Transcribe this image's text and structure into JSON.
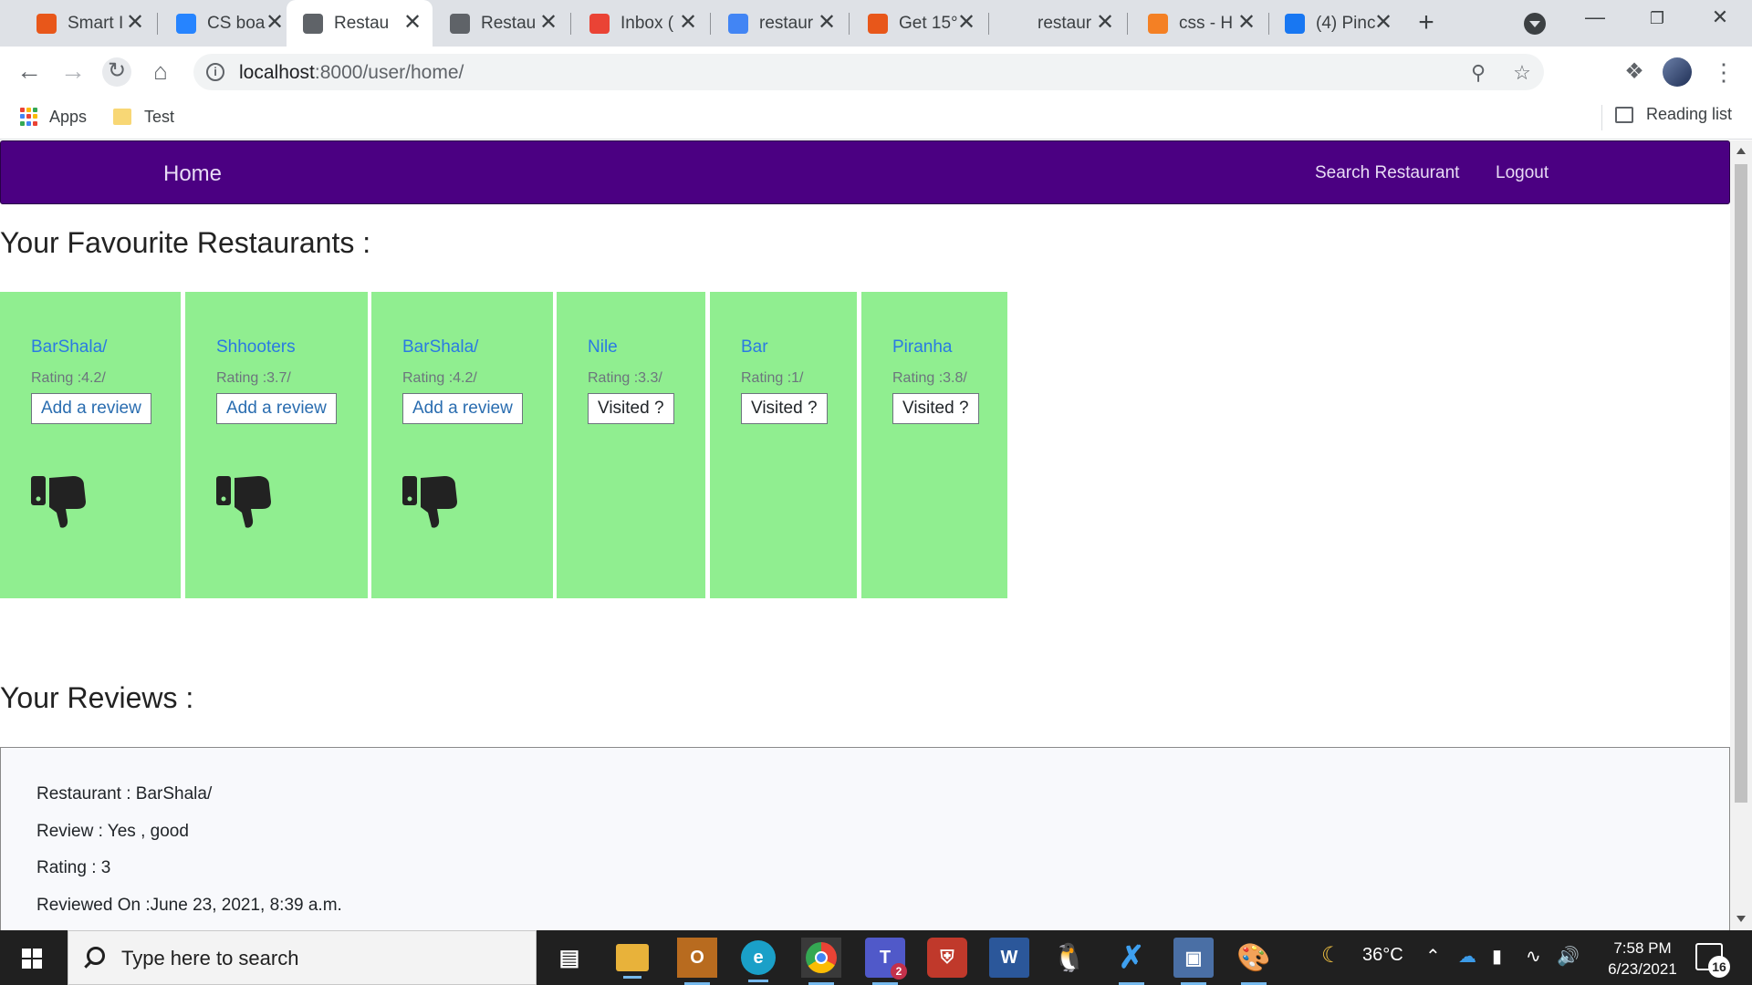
{
  "browser": {
    "tabs": [
      {
        "title": "Smart I",
        "icon": "smartsheet-icon",
        "color": "#e8571a"
      },
      {
        "title": "CS boa",
        "icon": "jira-icon",
        "color": "#2684ff"
      },
      {
        "title": "Restau",
        "icon": "globe-icon",
        "color": "#5f6368",
        "active": true
      },
      {
        "title": "Restau",
        "icon": "document-icon",
        "color": "#5f6368"
      },
      {
        "title": "Inbox (",
        "icon": "gmail-icon",
        "color": "#ea4335"
      },
      {
        "title": "restaur",
        "icon": "google-icon",
        "color": "#4285f4"
      },
      {
        "title": "Get 15°",
        "icon": "coupon-icon",
        "color": "#e8571a"
      },
      {
        "title": "restaur",
        "icon": "blank-icon",
        "color": "#dee1e6"
      },
      {
        "title": "css - H",
        "icon": "stackoverflow-icon",
        "color": "#f48024"
      },
      {
        "title": "(4) Pinc",
        "icon": "facebook-icon",
        "color": "#1877f2"
      }
    ],
    "tab_close_glyph": "✕",
    "new_tab_glyph": "+",
    "url_host": "localhost",
    "url_path": ":8000/user/home/",
    "bookmarks": {
      "apps_label": "Apps",
      "folder_label": "Test",
      "reading_list_label": "Reading list"
    }
  },
  "site": {
    "brand": "Home",
    "nav_links": [
      "Search Restaurant",
      "Logout"
    ],
    "favourites_title": "Your Favourite Restaurants :",
    "reviews_title": "Your Reviews :",
    "restaurants": [
      {
        "name": "BarShala/",
        "rating": "Rating :4.2/",
        "button": "Add a review",
        "button_kind": "review",
        "disliked": true
      },
      {
        "name": "Shhooters",
        "rating": "Rating :3.7/",
        "button": "Add a review",
        "button_kind": "review",
        "disliked": true
      },
      {
        "name": "BarShala/",
        "rating": "Rating :4.2/",
        "button": "Add a review",
        "button_kind": "review",
        "disliked": true
      },
      {
        "name": "Nile",
        "rating": "Rating :3.3/",
        "button": "Visited ?",
        "button_kind": "visited",
        "disliked": false
      },
      {
        "name": "Bar",
        "rating": "Rating :1/",
        "button": "Visited ?",
        "button_kind": "visited",
        "disliked": false
      },
      {
        "name": "Piranha",
        "rating": "Rating :3.8/",
        "button": "Visited ?",
        "button_kind": "visited",
        "disliked": false
      }
    ],
    "review": {
      "restaurant": "Restaurant : BarShala/",
      "review": "Review : Yes , good",
      "rating": "Rating : 3",
      "reviewed_on": "Reviewed On :June 23, 2021, 8:39 a.m."
    },
    "colors": {
      "navbar": "#4b0082",
      "card": "#90ee90",
      "link": "#2a7ae2"
    }
  },
  "taskbar": {
    "search_placeholder": "Type here to search",
    "weather": "36°C",
    "time": "7:58 PM",
    "date": "6/23/2021",
    "notification_count": "16",
    "teams_badge": "2"
  }
}
